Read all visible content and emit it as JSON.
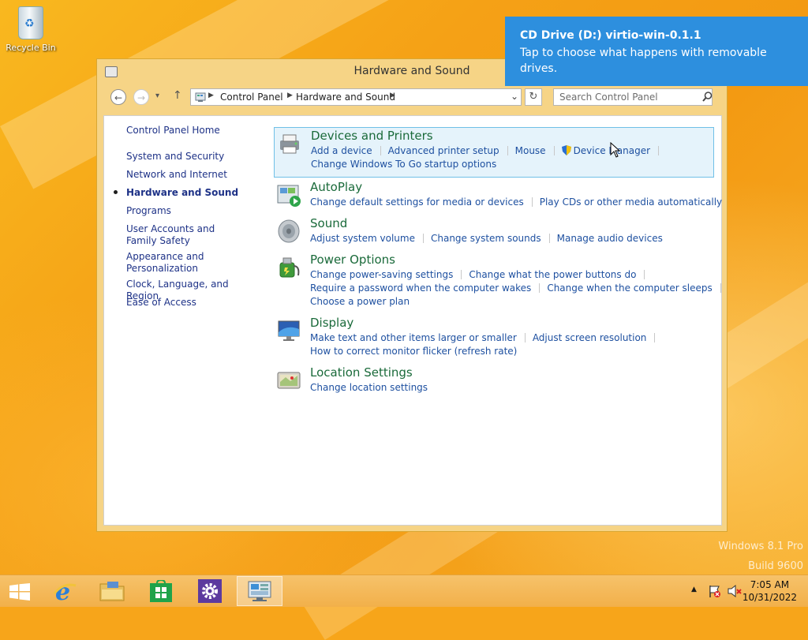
{
  "desktop": {
    "recycle_bin_label": "Recycle Bin",
    "watermark_line1": "Windows 8.1 Pro",
    "watermark_line2": "Build 9600"
  },
  "window": {
    "title": "Hardware and Sound",
    "address": [
      "Control Panel",
      "Hardware and Sound"
    ],
    "search_placeholder": "Search Control Panel",
    "refresh_label": "↻",
    "back_label": "←",
    "forward_label": "→",
    "up_label": "↑",
    "recent_label": "▾"
  },
  "leftnav": {
    "home": "Control Panel Home",
    "items": [
      "System and Security",
      "Network and Internet",
      "Hardware and Sound",
      "Programs",
      "User Accounts and Family Safety",
      "Appearance and Personalization",
      "Clock, Language, and Region",
      "Ease of Access"
    ],
    "current": "Hardware and Sound"
  },
  "categories": {
    "devices": {
      "title": "Devices and Printers",
      "links": [
        "Add a device",
        "Advanced printer setup",
        "Mouse",
        "Device Manager"
      ],
      "links2": [
        "Change Windows To Go startup options"
      ]
    },
    "autoplay": {
      "title": "AutoPlay",
      "links": [
        "Change default settings for media or devices",
        "Play CDs or other media automatically"
      ]
    },
    "sound": {
      "title": "Sound",
      "links": [
        "Adjust system volume",
        "Change system sounds",
        "Manage audio devices"
      ]
    },
    "power": {
      "title": "Power Options",
      "links": [
        "Change power-saving settings",
        "Change what the power buttons do"
      ],
      "links2": [
        "Require a password when the computer wakes",
        "Change when the computer sleeps"
      ],
      "links3": [
        "Choose a power plan"
      ]
    },
    "display": {
      "title": "Display",
      "links": [
        "Make text and other items larger or smaller",
        "Adjust screen resolution"
      ],
      "links2": [
        "How to correct monitor flicker (refresh rate)"
      ]
    },
    "location": {
      "title": "Location Settings",
      "links": [
        "Change location settings"
      ]
    }
  },
  "toast": {
    "title": "CD Drive (D:) virtio-win-0.1.1",
    "message": "Tap to choose what happens with removable drives."
  },
  "taskbar": {
    "time": "7:05 AM",
    "date": "10/31/2022",
    "tray_chevron": "▲"
  },
  "colors": {
    "toast": "#2d8fde",
    "category_title": "#1a6a3a",
    "link": "#1e50a0",
    "nav_link": "#1e3287"
  }
}
